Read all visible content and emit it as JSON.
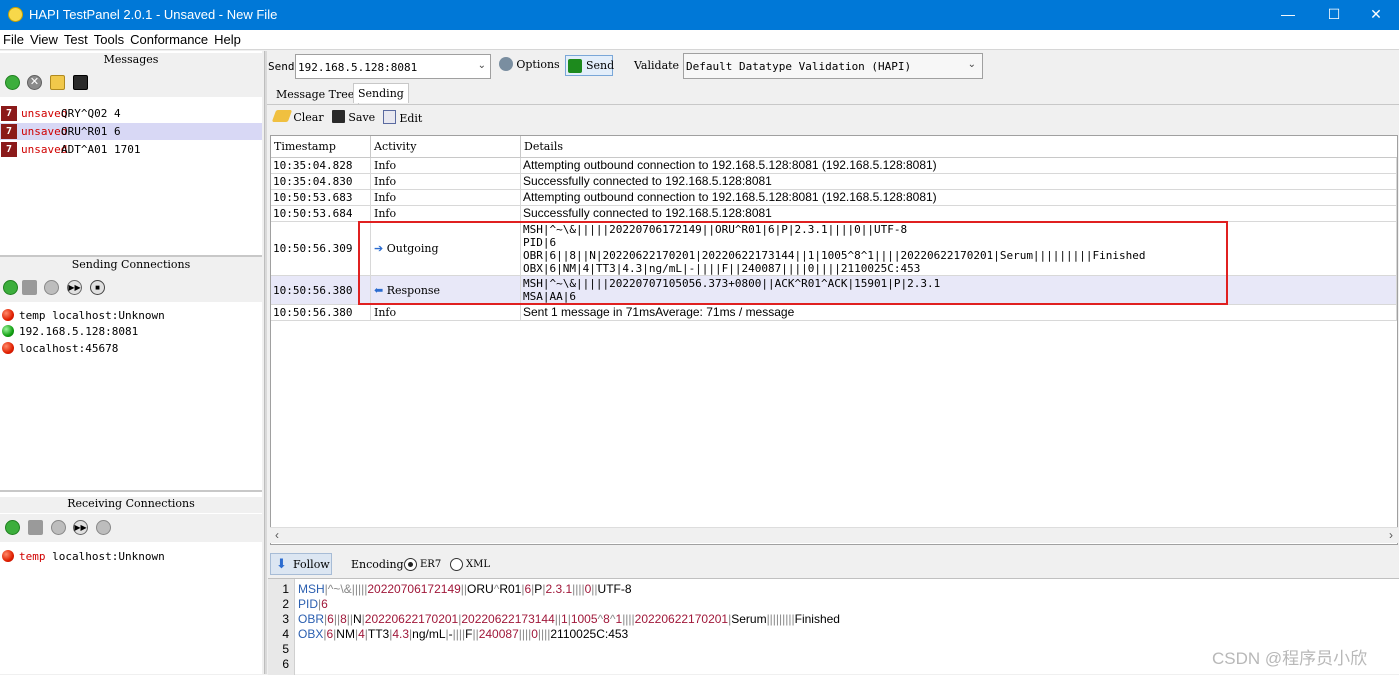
{
  "window": {
    "title": "HAPI TestPanel 2.0.1 - Unsaved - New File",
    "minimize": "—",
    "maximize": "☐",
    "close": "✕"
  },
  "menu": [
    "File",
    "View",
    "Test",
    "Tools",
    "Conformance",
    "Help"
  ],
  "messages_panel": {
    "title": "Messages",
    "items": [
      {
        "status": "unsaved",
        "name": "QRY^Q02 4"
      },
      {
        "status": "unsaved",
        "name": "ORU^R01 6"
      },
      {
        "status": "unsaved",
        "name": "ADT^A01 1701"
      }
    ]
  },
  "sending_connections": {
    "title": "Sending Connections",
    "items": [
      {
        "label": "temp localhost:Unknown",
        "state": "red"
      },
      {
        "label": "192.168.5.128:8081",
        "state": "green"
      },
      {
        "label": "localhost:45678",
        "state": "red"
      }
    ]
  },
  "receiving_connections": {
    "title": "Receiving Connections",
    "items": [
      {
        "prefix": "temp",
        "label": "localhost:Unknown",
        "state": "red"
      }
    ]
  },
  "toolbar": {
    "send_label": "Send",
    "send_target": "192.168.5.128:8081",
    "options_label": "Options",
    "send_button": "Send",
    "validate_label": "Validate",
    "validate_value": "Default Datatype Validation (HAPI)"
  },
  "tabs": [
    "Message Tree",
    "Sending"
  ],
  "activity_toolbar": {
    "clear": "Clear",
    "save": "Save",
    "edit": "Edit"
  },
  "table": {
    "columns": [
      "Timestamp",
      "Activity",
      "Details"
    ],
    "rows": [
      {
        "ts": "10:35:04.828",
        "act": "Info",
        "lines": [
          "Attempting outbound connection to 192.168.5.128:8081 (192.168.5.128:8081)"
        ]
      },
      {
        "ts": "10:35:04.830",
        "act": "Info",
        "lines": [
          "Successfully connected to 192.168.5.128:8081"
        ]
      },
      {
        "ts": "10:50:53.683",
        "act": "Info",
        "lines": [
          "Attempting outbound connection to 192.168.5.128:8081 (192.168.5.128:8081)"
        ]
      },
      {
        "ts": "10:50:53.684",
        "act": "Info",
        "lines": [
          "Successfully connected to 192.168.5.128:8081"
        ]
      },
      {
        "ts": "10:50:56.309",
        "act": "Outgoing",
        "lines": [
          "MSH|^~\\&|||||20220706172149||ORU^R01|6|P|2.3.1||||0||UTF-8",
          "PID|6",
          "OBR|6||8||N|20220622170201|20220622173144||1|1005^8^1||||20220622170201|Serum|||||||||Finished",
          "OBX|6|NM|4|TT3|4.3|ng/mL|-||||F||240087||||0||||2110025C:453"
        ]
      },
      {
        "ts": "10:50:56.380",
        "act": "Response",
        "lines": [
          "MSH|^~\\&|||||20220707105056.373+0800||ACK^R01^ACK|15901|P|2.3.1",
          "MSA|AA|6"
        ]
      },
      {
        "ts": "10:50:56.380",
        "act": "Info",
        "lines": [
          "Sent 1 message in 71msAverage: 71ms / message"
        ]
      }
    ]
  },
  "bottom": {
    "follow": "Follow",
    "encoding": "Encoding",
    "er7": "ER7",
    "xml": "XML"
  },
  "editor_lines": [
    "MSH|^~\\&|||||20220706172149||ORU^R01|6|P|2.3.1||||0||UTF-8",
    "PID|6",
    "OBR|6||8||N|20220622170201|20220622173144||1|1005^8^1||||20220622170201|Serum|||||||||Finished",
    "OBX|6|NM|4|TT3|4.3|ng/mL|-||||F||240087||||0||||2110025C:453",
    "",
    ""
  ],
  "watermark": "CSDN @程序员小欣",
  "colors": {
    "titlebar": "#0078d7",
    "unsaved": "#d00000",
    "highlight": "#e02020",
    "segment": "#2b5fb0"
  }
}
